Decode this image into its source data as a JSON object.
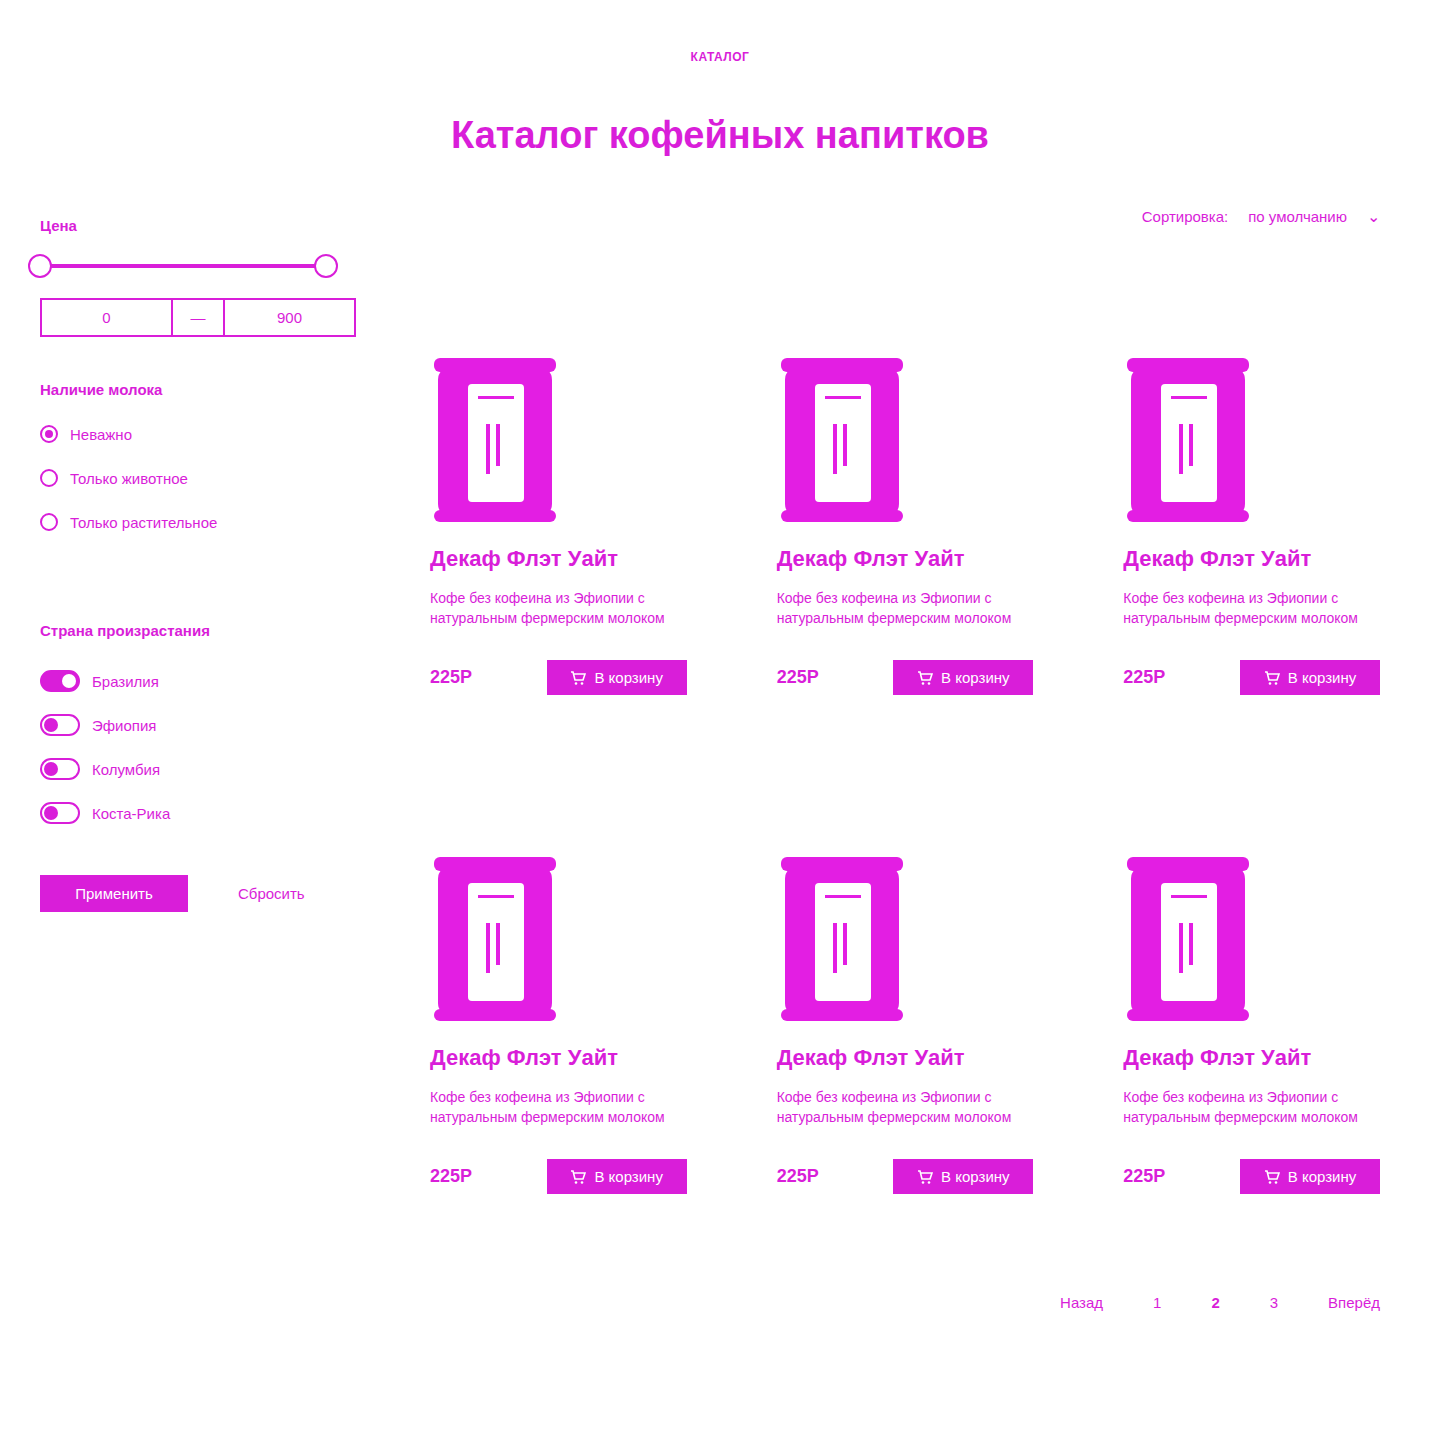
{
  "breadcrumb": "КАТАЛОГ",
  "title": "Каталог кофейных напитков",
  "sort": {
    "label": "Сортировка:",
    "value": "по умолчанию",
    "icon": "⌄"
  },
  "filters": {
    "price": {
      "title": "Цена",
      "min": "0",
      "max": "900",
      "separator": "—",
      "level": 1
    },
    "milk": {
      "title": "Наличие молока",
      "options": [
        {
          "label": "Неважно",
          "selected": true
        },
        {
          "label": "Только животное",
          "selected": false
        },
        {
          "label": "Только растительное",
          "selected": false
        }
      ]
    },
    "country": {
      "title": "Страна произрастания",
      "items": [
        {
          "label": "Бразилия",
          "on": true
        },
        {
          "label": "Эфиопия",
          "on": false
        },
        {
          "label": "Колумбия",
          "on": false
        },
        {
          "label": "Коста-Рика",
          "on": false
        }
      ]
    },
    "apply": "Применить",
    "reset": "Сбросить"
  },
  "products": [
    {
      "name": "Декаф Флэт Уайт",
      "description": "Кофе без кофеина из Эфиопии с натуральным фермерским молоком",
      "price": "225Р",
      "button": "В корзину"
    },
    {
      "name": "Декаф Флэт Уайт",
      "description": "Кофе без кофеина из Эфиопии с натуральным фермерским молоком",
      "price": "225Р",
      "button": "В корзину"
    },
    {
      "name": "Декаф Флэт Уайт",
      "description": "Кофе без кофеина из Эфиопии с натуральным фермерским молоком",
      "price": "225Р",
      "button": "В корзину"
    },
    {
      "name": "Декаф Флэт Уайт",
      "description": "Кофе без кофеина из Эфиопии с натуральным фермерским молоком",
      "price": "225Р",
      "button": "В корзину"
    },
    {
      "name": "Декаф Флэт Уайт",
      "description": "Кофе без кофеина из Эфиопии с натуральным фермерским молоком",
      "price": "225Р",
      "button": "В корзину"
    },
    {
      "name": "Декаф Флэт Уайт",
      "description": "Кофе без кофеина из Эфиопии с натуральным фермерским молоком",
      "price": "225Р",
      "button": "В корзину"
    }
  ],
  "pagination": {
    "prev": "Назад",
    "next": "Вперёд",
    "pages": [
      {
        "label": "1",
        "selected": false
      },
      {
        "label": "2",
        "selected": true
      },
      {
        "label": "3",
        "selected": false
      }
    ]
  }
}
